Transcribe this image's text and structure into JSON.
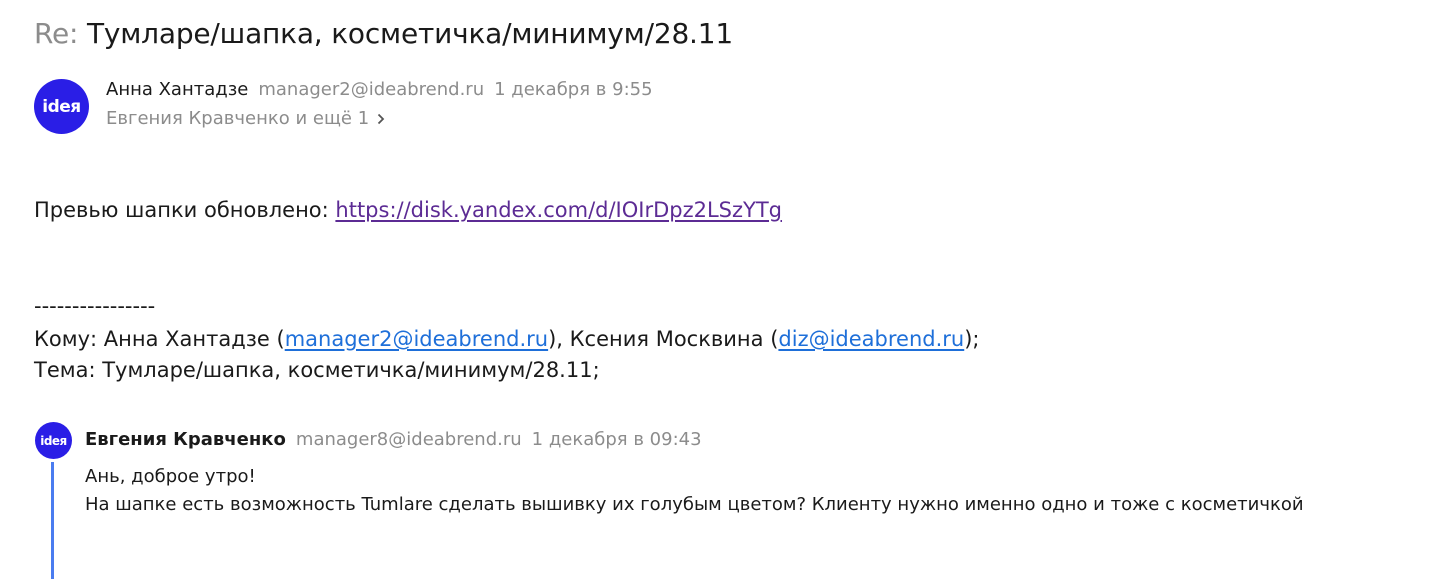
{
  "subject": {
    "prefix": "Re:",
    "title": "Тумларе/шапка, косметичка/минимум/28.11"
  },
  "message": {
    "avatar_text": "ideя",
    "sender_name": "Анна Хантадзе",
    "sender_email": "manager2@ideabrend.ru",
    "date": "1 декабря в 9:55",
    "recipients": "Евгения Кравченко и ещё 1",
    "preview_label": "Превью шапки обновлено:",
    "preview_link": "https://disk.yandex.com/d/IOIrDpz2LSzYTg",
    "divider": "----------------",
    "to_prefix": "Кому: Анна Хантадзе (",
    "to_email1": "manager2@ideabrend.ru",
    "to_middle": "), Ксения Москвина (",
    "to_email2": "diz@ideabrend.ru",
    "to_suffix": ");",
    "subject_line": "Тема: Тумларе/шапка, косметичка/минимум/28.11;"
  },
  "quoted": {
    "avatar_text": "ideя",
    "sender_name": "Евгения Кравченко",
    "sender_email": "manager8@ideabrend.ru",
    "date": "1 декабря в 09:43",
    "line1": "Ань, доброе утро!",
    "line2": "На шапке есть возможность Tumlare сделать вышивку их голубым цветом? Клиенту нужно именно одно и тоже с косметичкой"
  },
  "colors": {
    "avatar_bg": "#2a1ee6",
    "quote_bar": "#4a7cf0",
    "link": "#1e6fd9",
    "visited_link": "#5c2b94",
    "muted": "#8c8c8c"
  },
  "icons": {
    "recipients_expand": "chevron-right-icon"
  }
}
